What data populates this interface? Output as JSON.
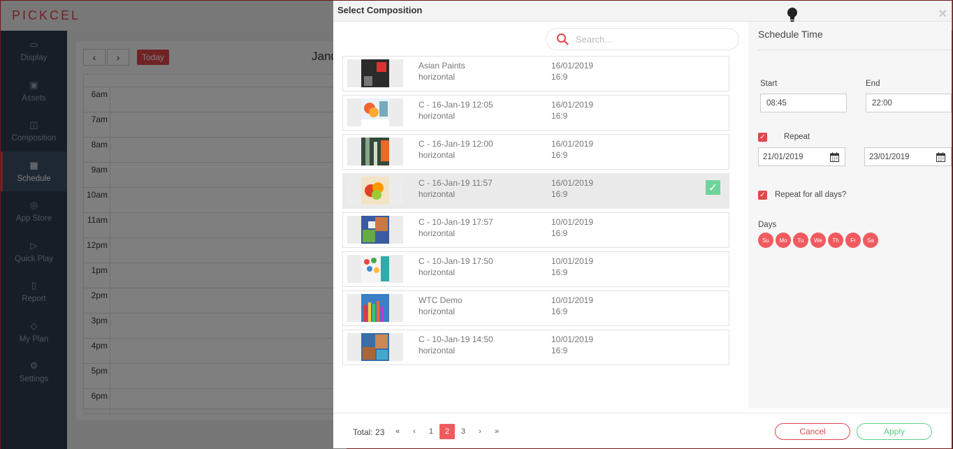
{
  "app": {
    "logo": "PICKCEL",
    "sidebar": [
      {
        "icon": "monitor-icon",
        "glyph": "▭",
        "label": "Display"
      },
      {
        "icon": "image-icon",
        "glyph": "▣",
        "label": "Assets"
      },
      {
        "icon": "layout-icon",
        "glyph": "◫",
        "label": "Composition"
      },
      {
        "icon": "calendar-icon",
        "glyph": "▦",
        "label": "Schedule",
        "active": true
      },
      {
        "icon": "compass-icon",
        "glyph": "◎",
        "label": "App Store"
      },
      {
        "icon": "play-icon",
        "glyph": "▷",
        "label": "Quick Play"
      },
      {
        "icon": "book-icon",
        "glyph": "▯",
        "label": "Report"
      },
      {
        "icon": "diamond-icon",
        "glyph": "◇",
        "label": "My Plan"
      },
      {
        "icon": "gear-icon",
        "glyph": "⚙",
        "label": "Settings"
      }
    ],
    "calendar": {
      "prev": "‹",
      "next": "›",
      "today_label": "Today",
      "title": "Janu",
      "hours": [
        "6am",
        "7am",
        "8am",
        "9am",
        "10am",
        "11am",
        "12pm",
        "1pm",
        "2pm",
        "3pm",
        "4pm",
        "5pm",
        "6pm"
      ]
    }
  },
  "modal": {
    "title": "Select Composition",
    "close": "✕",
    "search": {
      "placeholder": "Search..."
    },
    "compositions": [
      {
        "name": "Asian Paints",
        "orientation": "horizontal",
        "date": "16/01/2019",
        "ratio": "16:9",
        "selected": false
      },
      {
        "name": "C - 16-Jan-19 12:05",
        "orientation": "horizontal",
        "date": "16/01/2019",
        "ratio": "16:9",
        "selected": false
      },
      {
        "name": "C - 16-Jan-19 12:00",
        "orientation": "horizontal",
        "date": "16/01/2019",
        "ratio": "16:9",
        "selected": false
      },
      {
        "name": "C - 16-Jan-19 11:57",
        "orientation": "horizontal",
        "date": "16/01/2019",
        "ratio": "16:9",
        "selected": true
      },
      {
        "name": "C - 10-Jan-19 17:57",
        "orientation": "horizontal",
        "date": "10/01/2019",
        "ratio": "16:9",
        "selected": false
      },
      {
        "name": "C - 10-Jan-19 17:50",
        "orientation": "horizontal",
        "date": "10/01/2019",
        "ratio": "16:9",
        "selected": false
      },
      {
        "name": "WTC Demo",
        "orientation": "horizontal",
        "date": "10/01/2019",
        "ratio": "16:9",
        "selected": false
      },
      {
        "name": "C - 10-Jan-19 14:50",
        "orientation": "horizontal",
        "date": "10/01/2019",
        "ratio": "16:9",
        "selected": false
      }
    ],
    "schedule": {
      "title": "Schedule Time",
      "start_label": "Start",
      "start_value": "08:45",
      "end_label": "End",
      "end_value": "22:00",
      "repeat_label": "Repeat",
      "repeat_checked": true,
      "repeat_from": "21/01/2019",
      "repeat_to": "23/01/2019",
      "repeat_all_label": "Repeat for all days?",
      "repeat_all_checked": true,
      "days_label": "Days",
      "days": [
        "Su",
        "Mo",
        "Tu",
        "We",
        "Th",
        "Fr",
        "Sa"
      ]
    },
    "footer": {
      "total": "Total: 23",
      "pages": [
        "«",
        "‹",
        "1",
        "2",
        "3",
        "›",
        "»"
      ],
      "current_page": "2",
      "cancel_label": "Cancel",
      "apply_label": "Apply"
    }
  },
  "colors": {
    "accent": "#e0474c",
    "sidebar_bg": "#2c3e50",
    "apply_green": "#5ccf8a",
    "check_green": "#6fd49b"
  }
}
